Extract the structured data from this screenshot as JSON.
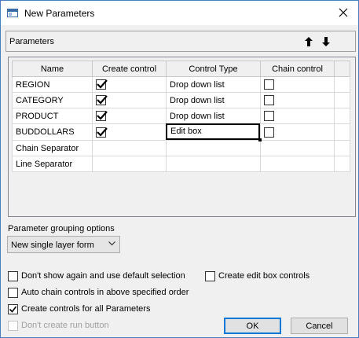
{
  "window": {
    "title": "New Parameters"
  },
  "section": {
    "title": "Parameters"
  },
  "grid": {
    "columns": [
      "Name",
      "Create control",
      "Control Type",
      "Chain control"
    ],
    "rows": [
      {
        "name": "REGION",
        "create": true,
        "control_type": "Drop down list",
        "chain": false
      },
      {
        "name": "CATEGORY",
        "create": true,
        "control_type": "Drop down list",
        "chain": false
      },
      {
        "name": "PRODUCT",
        "create": true,
        "control_type": "Drop down list",
        "chain": false
      },
      {
        "name": "BUDDOLLARS",
        "create": true,
        "control_type": "Edit box",
        "chain": false
      },
      {
        "name": "Chain Separator",
        "create": null,
        "control_type": "",
        "chain": null
      },
      {
        "name": "Line Separator",
        "create": null,
        "control_type": "",
        "chain": null
      }
    ]
  },
  "grouping": {
    "label": "Parameter grouping options",
    "selected": "New single layer form"
  },
  "options": {
    "dont_show_again": {
      "label": "Don't show again and use default selection",
      "checked": false
    },
    "create_edit_box": {
      "label": "Create edit box controls",
      "checked": false
    },
    "auto_chain": {
      "label": "Auto chain controls in above specified order",
      "checked": false
    },
    "create_all": {
      "label": "Create controls for all Parameters",
      "checked": true
    },
    "dont_create_run": {
      "label": "Don't create run button",
      "checked": false,
      "disabled": true
    }
  },
  "buttons": {
    "ok": "OK",
    "cancel": "Cancel"
  },
  "colors": {
    "accent": "#0078d7",
    "window_border": "#4a7dbd",
    "dialog_bg": "#f0f0f0"
  }
}
